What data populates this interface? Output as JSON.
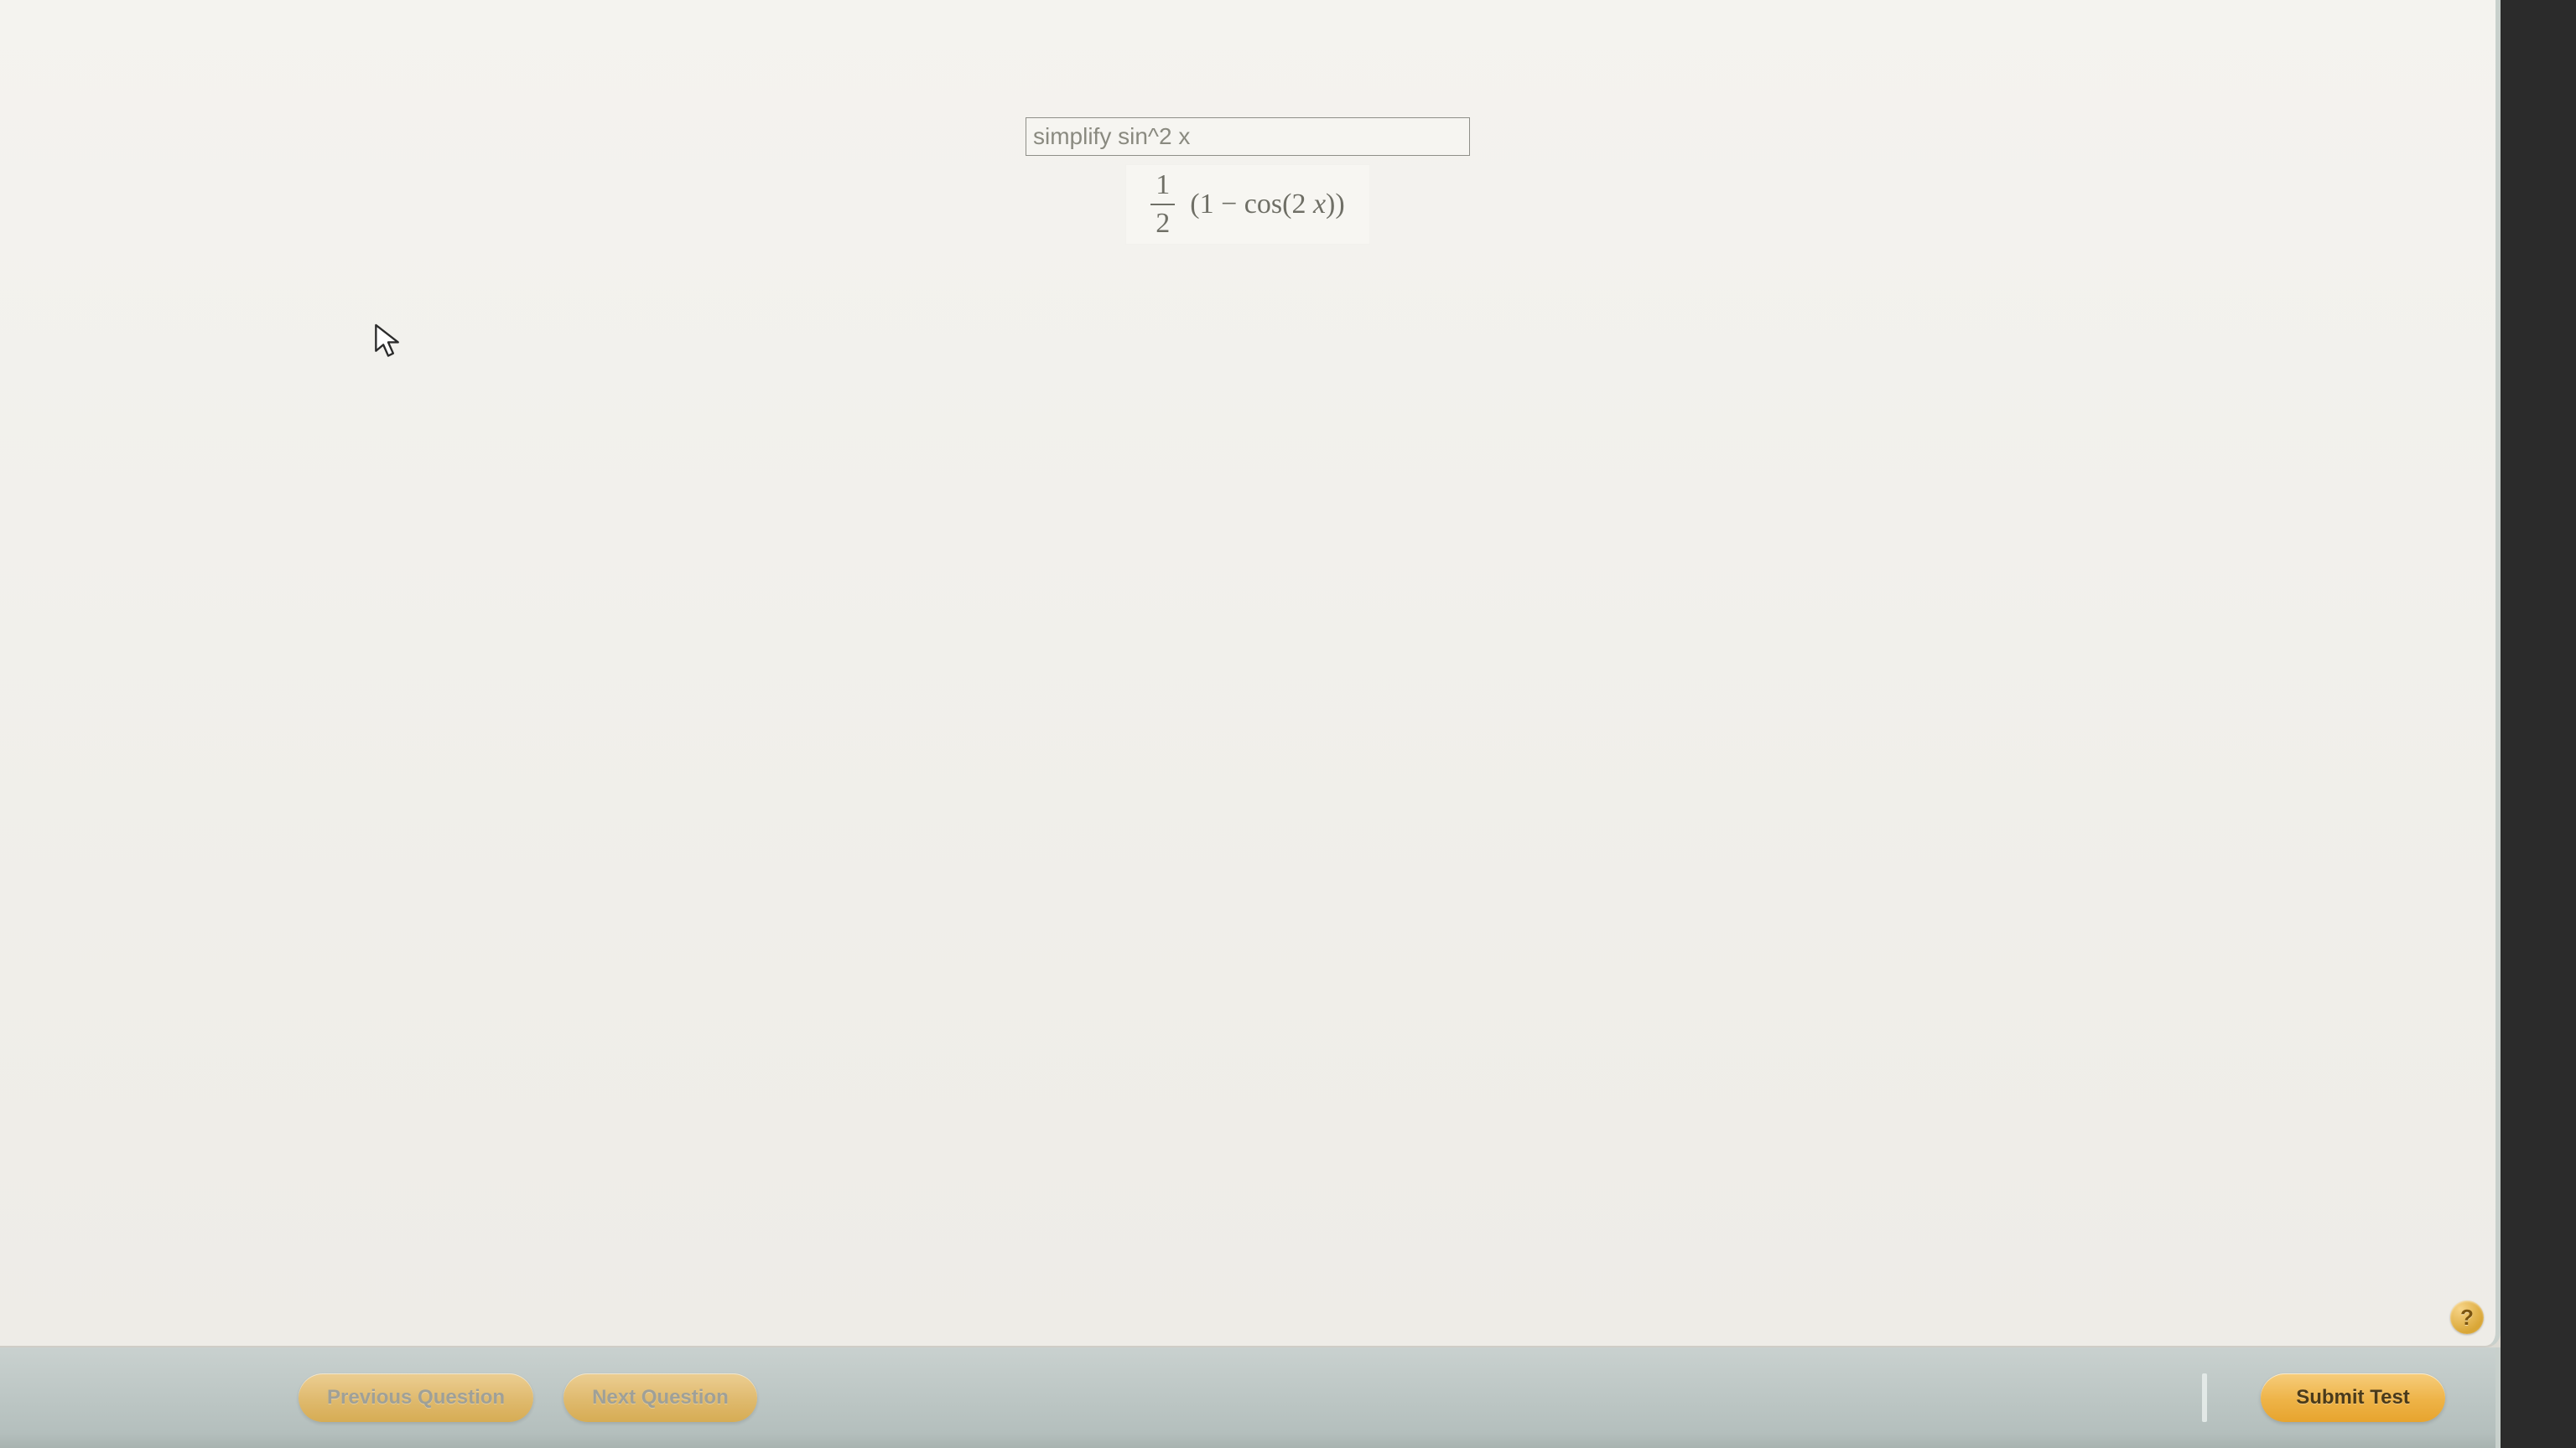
{
  "query": {
    "value": "simplify sin^2 x"
  },
  "formula": {
    "numerator": "1",
    "denominator": "2",
    "rest_prefix": "(1 − cos(2 ",
    "rest_var": "x",
    "rest_suffix": "))"
  },
  "help": {
    "label": "?"
  },
  "footer": {
    "prev_label": "Previous Question",
    "next_label": "Next Question",
    "submit_label": "Submit Test"
  }
}
